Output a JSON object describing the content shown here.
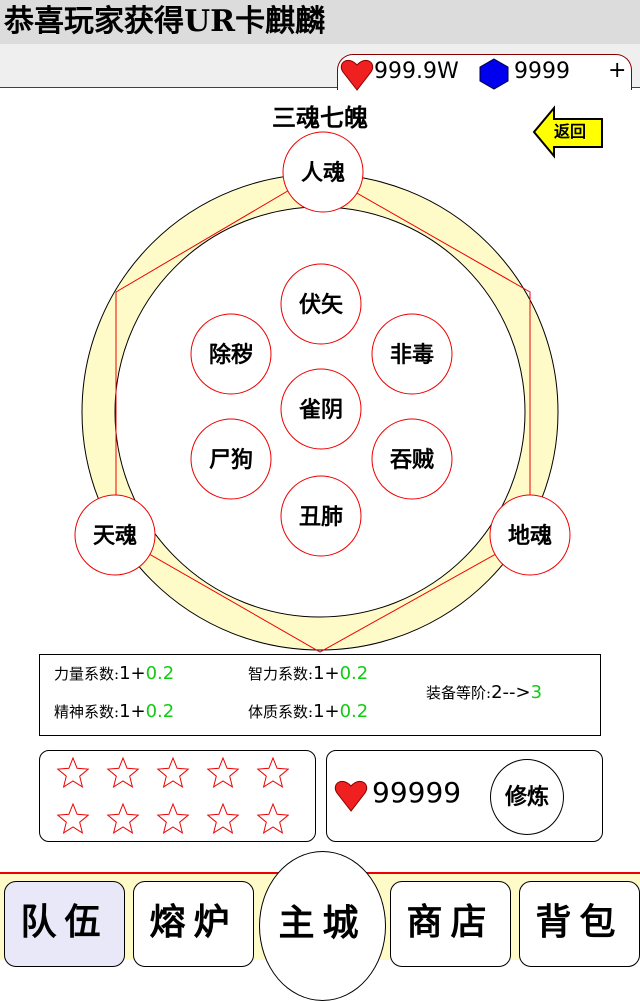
{
  "banner": "恭喜玩家获得UR卡麒麟",
  "currency": {
    "hearts": "999.9W",
    "gems": "9999",
    "add": "+",
    "heart_color": "#f02020",
    "gem_color": "#0000ee"
  },
  "title": "三魂七魄",
  "back_label": "返回",
  "hun": {
    "top": "人魂",
    "left": "天魂",
    "right": "地魂"
  },
  "po": [
    "伏矢",
    "除秽",
    "非毒",
    "雀阴",
    "尸狗",
    "吞贼",
    "丑肺"
  ],
  "stats": {
    "strength": {
      "label": "力量系数:",
      "base": "1+",
      "bonus": "0.2"
    },
    "intellect": {
      "label": "智力系数:",
      "base": "1+",
      "bonus": "0.2"
    },
    "spirit": {
      "label": "精神系数:",
      "base": "1+",
      "bonus": "0.2"
    },
    "constitution": {
      "label": "体质系数:",
      "base": "1+",
      "bonus": "0.2"
    },
    "equip": {
      "label": "装备等阶:",
      "from": "2-->",
      "to": "3"
    }
  },
  "stars": {
    "filled": 0,
    "total": 10
  },
  "train": {
    "cost": "99999",
    "button": "修炼"
  },
  "nav": {
    "team": "队伍",
    "furnace": "熔炉",
    "city": "主城",
    "shop": "商店",
    "bag": "背包"
  }
}
